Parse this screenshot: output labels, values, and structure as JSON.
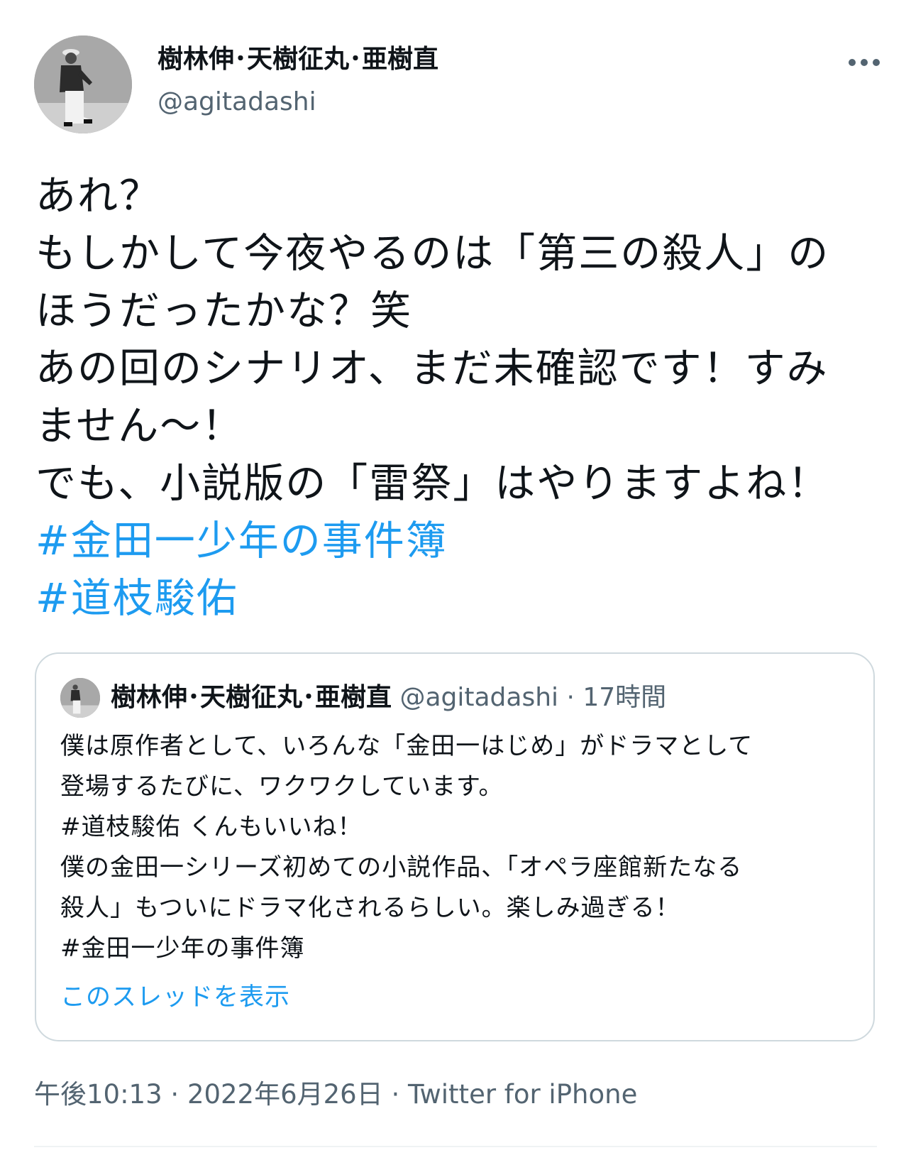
{
  "author": {
    "name": "樹林伸･天樹征丸･亜樹直",
    "handle": "@agitadashi",
    "avatar_icon": "profile-photo"
  },
  "more_icon": "more-horizontal-icon",
  "tweet": {
    "lines": [
      "あれ？",
      "もしかして今夜やるのは「第三の殺人」の",
      "ほうだったかな？笑",
      "あの回のシナリオ、まだ未確認です！すみ",
      "ません〜！",
      "でも、小説版の「雷祭」はやりますよね！"
    ],
    "hashtags": [
      "#金田一少年の事件簿",
      "#道枝駿佑"
    ]
  },
  "quoted_tweet": {
    "name": "樹林伸･天樹征丸･亜樹直",
    "handle": "@agitadashi",
    "time": " · 17時間",
    "lines": [
      "僕は原作者として、いろんな「金田一はじめ」がドラマとして",
      "登場するたびに、ワクワクしています。",
      "#道枝駿佑 くんもいいね！",
      "僕の金田一シリーズ初めての小説作品、「オペラ座館新たなる",
      "殺人」もついにドラマ化されるらしい。楽しみ過ぎる！",
      "#金田一少年の事件簿"
    ],
    "show_thread": "このスレッドを表示"
  },
  "meta": {
    "time": "午後10:13",
    "date": "2022年6月26日",
    "source": "Twitter for iPhone",
    "separator": " · "
  },
  "colors": {
    "link": "#1d9bf0",
    "text": "#0f1419",
    "secondary": "#536471",
    "border": "#cfd9de"
  }
}
